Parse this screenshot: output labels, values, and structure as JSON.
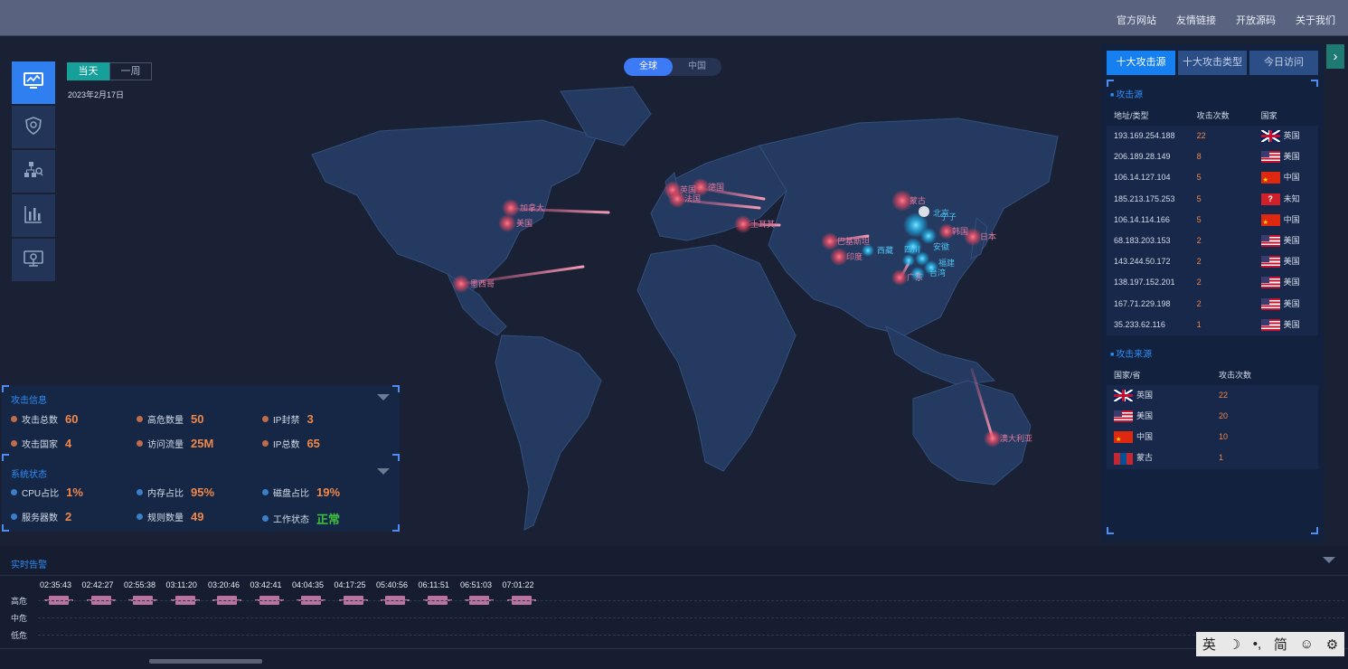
{
  "top_links": [
    "官方网站",
    "友情链接",
    "开放源码",
    "关于我们"
  ],
  "sidenav": [
    {
      "icon": "monitor-chart-icon",
      "active": true
    },
    {
      "icon": "shield-icon",
      "active": false
    },
    {
      "icon": "network-search-icon",
      "active": false
    },
    {
      "icon": "bar-chart-icon",
      "active": false
    },
    {
      "icon": "location-screen-icon",
      "active": false
    }
  ],
  "time_toggle": {
    "today": "当天",
    "week": "一周"
  },
  "date": "2023年2月17日",
  "scope_toggle": {
    "global": "全球",
    "china": "中国"
  },
  "map_labels": {
    "canada": "加拿大",
    "usa": "美国",
    "mexico": "墨西哥",
    "uk": "英国",
    "germany": "德国",
    "france": "法国",
    "turkey": "土耳其",
    "mongolia": "蒙古",
    "beijing": "北京",
    "korea": "韩国",
    "japan": "日本",
    "australia": "澳大利亚",
    "india": "印度",
    "pakistan": "巴基斯坦",
    "tibet": "西藏",
    "sichuan": "四川",
    "anhui": "安徽",
    "fujian": "福建",
    "taiwan": "台湾",
    "guangdong": "广东",
    "ningzi": "宁子"
  },
  "right_panel": {
    "tabs": [
      "十大攻击源",
      "十大攻击类型",
      "今日访问"
    ],
    "source_title": "攻击源",
    "source_headers": [
      "地址/类型",
      "攻击次数",
      "国家"
    ],
    "sources": [
      {
        "ip": "193.169.254.188",
        "count": "22",
        "flag": "gb",
        "country": "英国"
      },
      {
        "ip": "206.189.28.149",
        "count": "8",
        "flag": "us",
        "country": "美国"
      },
      {
        "ip": "106.14.127.104",
        "count": "5",
        "flag": "cn",
        "country": "中国"
      },
      {
        "ip": "185.213.175.253",
        "count": "5",
        "flag": "unknown",
        "country": "未知"
      },
      {
        "ip": "106.14.114.166",
        "count": "5",
        "flag": "cn",
        "country": "中国"
      },
      {
        "ip": "68.183.203.153",
        "count": "2",
        "flag": "us",
        "country": "美国"
      },
      {
        "ip": "143.244.50.172",
        "count": "2",
        "flag": "us",
        "country": "美国"
      },
      {
        "ip": "138.197.152.201",
        "count": "2",
        "flag": "us",
        "country": "美国"
      },
      {
        "ip": "167.71.229.198",
        "count": "2",
        "flag": "us",
        "country": "美国"
      },
      {
        "ip": "35.233.62.116",
        "count": "1",
        "flag": "us",
        "country": "美国"
      }
    ],
    "origin_title": "攻击来源",
    "origin_headers": [
      "国家/省",
      "攻击次数"
    ],
    "origins": [
      {
        "flag": "gb",
        "name": "英国",
        "count": "22"
      },
      {
        "flag": "us",
        "name": "美国",
        "count": "20"
      },
      {
        "flag": "cn",
        "name": "中国",
        "count": "10"
      },
      {
        "flag": "mn",
        "name": "蒙古",
        "count": "1"
      }
    ]
  },
  "attack_info": {
    "title": "攻击信息",
    "stats": [
      {
        "label": "攻击总数",
        "value": "60"
      },
      {
        "label": "高危数量",
        "value": "50"
      },
      {
        "label": "IP封禁",
        "value": "3"
      },
      {
        "label": "攻击国家",
        "value": "4"
      },
      {
        "label": "访问流量",
        "value": "25M"
      },
      {
        "label": "IP总数",
        "value": "65"
      }
    ]
  },
  "system_status": {
    "title": "系统状态",
    "stats": [
      {
        "label": "CPU占比",
        "value": "1%"
      },
      {
        "label": "内存占比",
        "value": "95%"
      },
      {
        "label": "磁盘占比",
        "value": "19%"
      },
      {
        "label": "服务器数",
        "value": "2"
      },
      {
        "label": "规则数量",
        "value": "49"
      },
      {
        "label": "工作状态",
        "value": "正常"
      }
    ]
  },
  "alerts": {
    "title": "实时告警",
    "times": [
      "02:35:43",
      "02:42:27",
      "02:55:38",
      "03:11:20",
      "03:20:46",
      "03:42:41",
      "04:04:35",
      "04:17:25",
      "05:40:56",
      "06:11:51",
      "06:51:03",
      "07:01:22"
    ],
    "levels": [
      "高危",
      "中危",
      "低危"
    ]
  },
  "ime_bar": {
    "lang": "英",
    "script": "简"
  },
  "colors": {
    "accent": "#2f8cf5",
    "value": "#f0884a",
    "ok": "#3ec13e",
    "alert_pill": "#b9739f"
  }
}
